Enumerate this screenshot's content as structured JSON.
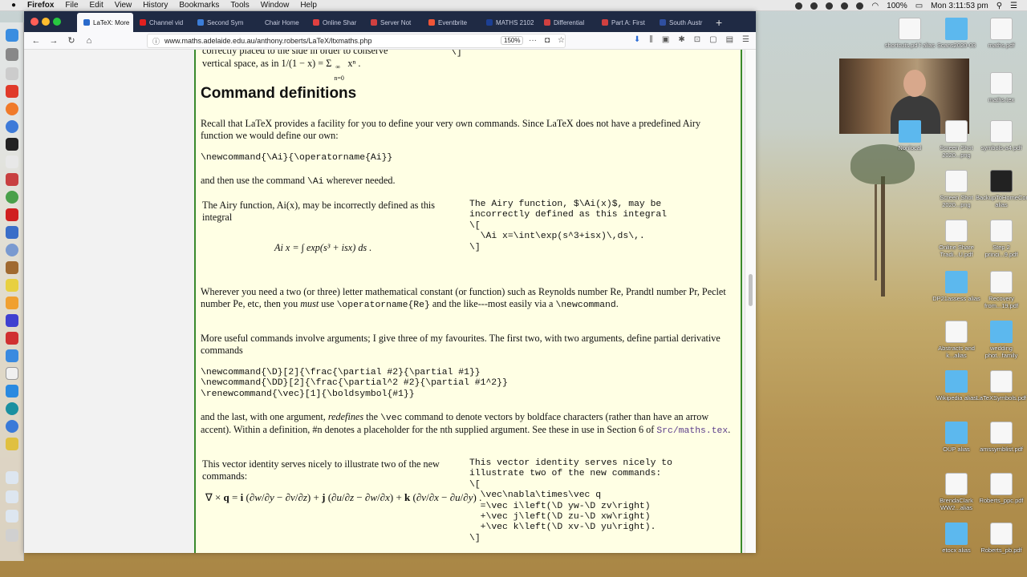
{
  "menubar": {
    "app": "Firefox",
    "items": [
      "File",
      "Edit",
      "View",
      "History",
      "Bookmarks",
      "Tools",
      "Window",
      "Help"
    ],
    "battery": "100%",
    "clock": "Mon 3:11:53 pm"
  },
  "tabs": [
    {
      "label": "LaTeX: More",
      "active": true,
      "color": "#2a6acb"
    },
    {
      "label": "Channel vid",
      "color": "#e02020"
    },
    {
      "label": "Second Sym",
      "color": "#3b7dd8"
    },
    {
      "label": "Chair Home",
      "color": "#1f2a44"
    },
    {
      "label": "Online Shar",
      "color": "#e04040"
    },
    {
      "label": "Server Not",
      "color": "#d04040"
    },
    {
      "label": "Eventbrite",
      "color": "#f05537"
    },
    {
      "label": "MATHS 2102",
      "color": "#1c3f94"
    },
    {
      "label": "Differential",
      "color": "#d04040"
    },
    {
      "label": "Part A: First",
      "color": "#d04040"
    },
    {
      "label": "South Austr",
      "color": "#2f4fa0"
    }
  ],
  "navbar": {
    "url": "www.maths.adelaide.edu.au/anthony.roberts/LaTeX/ltxmaths.php",
    "zoom": "150%"
  },
  "page": {
    "top_text_1": "correctly placed to the side in order to conserve",
    "top_text_2": "vertical space, as in 1/(1 − x) = Σ",
    "top_text_2b": "xⁿ .",
    "top_sum_sup": "∞",
    "top_sum_sub": "n=0",
    "top_code": "\\]",
    "section_title": "Command definitions",
    "p1": "Recall that LaTeX provides a facility for you to define your very own commands. Since LaTeX does not have a predefined Airy function we would define our own:",
    "code1": "\\newcommand{\\Ai}{\\operatorname{Ai}}",
    "p2a": "and then use the command ",
    "p2code": "\\Ai",
    "p2b": " wherever needed.",
    "airy_text": "The Airy function, Ai(x), may be incorrectly defined as this integral",
    "airy_math": "Ai x = ∫ exp(s³ + isx) ds .",
    "airy_code": "The Airy function, $\\Ai(x)$, may be\nincorrectly defined as this integral\n\\[\n  \\Ai x=\\int\\exp(s^3+isx)\\,ds\\,.\n\\]",
    "p3a": "Wherever you need a two (or three) letter mathematical constant (or function) such as Reynolds number Re, Prandtl number Pr, Peclet number Pe, etc, then you ",
    "p3em": "must",
    "p3b": " use ",
    "p3code": "\\operatorname{Re}",
    "p3c": " and the like---most easily via a ",
    "p3code2": "\\newcommand",
    "p3d": ".",
    "p4": "More useful commands involve arguments; I give three of my favourites. The first two, with two arguments, define partial derivative commands",
    "code2": "\\newcommand{\\D}[2]{\\frac{\\partial #2}{\\partial #1}}\n\\newcommand{\\DD}[2]{\\frac{\\partial^2 #2}{\\partial #1^2}}\n\\renewcommand{\\vec}[1]{\\boldsymbol{#1}}",
    "p5a": "and the last, with one argument, ",
    "p5em": "redefines",
    "p5b": " the ",
    "p5code": "\\vec",
    "p5c": " command to denote vectors by boldface characters (rather than have an arrow accent). Within a definition, #n denotes a placeholder for the nth supplied argument. See these in use in Section 6 of ",
    "p5link": "Src/maths.tex",
    "p5d": ".",
    "vec_text": "This vector identity serves nicely to illustrate two of the new commands:",
    "vec_code": "This vector identity serves nicely to\nillustrate two of the new commands:\n\\[\n  \\vec\\nabla\\times\\vec q\n  =\\vec i\\left(\\D yw-\\D zv\\right)\n  +\\vec j\\left(\\D zu-\\D xw\\right)\n  +\\vec k\\left(\\D xv-\\D yu\\right).\n\\]"
  },
  "desktop_icons": [
    {
      "label": "shortcuts.pd f alias",
      "kind": "doc"
    },
    {
      "label": "Scans2020-03",
      "kind": "folder"
    },
    {
      "label": "maths.pdf",
      "kind": "doc"
    },
    {
      "label": "maths.tex",
      "kind": "doc"
    },
    {
      "label": "Nonlocal",
      "kind": "folder"
    },
    {
      "label": "Screen Shot 2020...png",
      "kind": "doc"
    },
    {
      "label": "symbols-a4.pdf",
      "kind": "doc"
    },
    {
      "label": "Screen Shot 2020...png",
      "kind": "doc"
    },
    {
      "label": "BackupToHomeCommand alias",
      "kind": "dark"
    },
    {
      "label": "Online Share Tradi...U.pdf",
      "kind": "doc"
    },
    {
      "label": "Step 2 princi...9.pdf",
      "kind": "doc"
    },
    {
      "label": "DP21assess alias",
      "kind": "folder"
    },
    {
      "label": "Recovery from...19.pdf",
      "kind": "doc"
    },
    {
      "label": "Abstracts and k...alias",
      "kind": "doc"
    },
    {
      "label": "wedding phot...family",
      "kind": "folder"
    },
    {
      "label": "Wikipedia alias",
      "kind": "folder"
    },
    {
      "label": "LaTeXSymbols.pdf",
      "kind": "doc"
    },
    {
      "label": "OUP alias",
      "kind": "folder"
    },
    {
      "label": "amssymblist.pdf",
      "kind": "doc"
    },
    {
      "label": "BrendaClark WW2...alias",
      "kind": "doc"
    },
    {
      "label": "Roberts_ppc.pdf",
      "kind": "doc"
    },
    {
      "label": "etocx alias",
      "kind": "folder"
    },
    {
      "label": "Roberts_pb.pdf",
      "kind": "doc"
    }
  ]
}
